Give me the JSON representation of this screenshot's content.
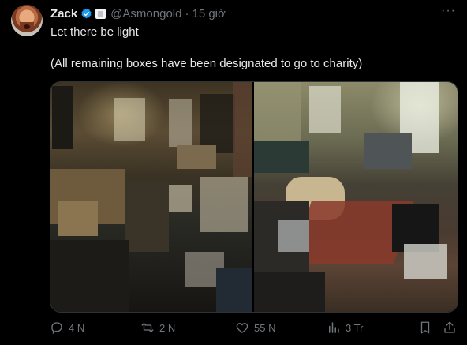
{
  "tweet": {
    "display_name": "Zack",
    "handle": "@Asmongold",
    "separator": "·",
    "time": "15 giờ",
    "more": "···",
    "text_line1": "Let there be light",
    "text_line2": "(All remaining boxes have been designated to go to charity)"
  },
  "actions": {
    "reply_count": "4 N",
    "retweet_count": "2 N",
    "like_count": "55 N",
    "views_count": "3 Tr"
  },
  "colors": {
    "background": "#000000",
    "text": "#e7e9ea",
    "muted": "#71767b",
    "verified": "#1d9bf0"
  },
  "icons": [
    "verified-badge-icon",
    "affiliate-badge-icon",
    "more-icon",
    "reply-icon",
    "retweet-icon",
    "like-icon",
    "views-icon",
    "bookmark-icon",
    "share-icon"
  ]
}
